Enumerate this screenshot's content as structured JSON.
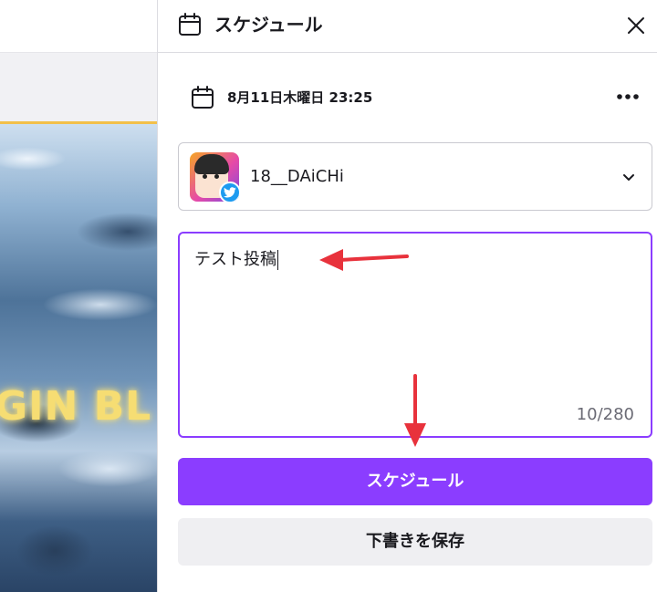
{
  "editor": {
    "canvas_text": "GIN BL"
  },
  "panel": {
    "title": "スケジュール",
    "header_icon": "calendar-icon",
    "close_icon": "close-icon",
    "date_icon": "calendar-icon",
    "date_text": "8月11日木曜日 23:25",
    "more_icon": "more-dots-icon"
  },
  "account": {
    "name": "18__DAiCHi",
    "platform_icon": "twitter-icon",
    "dropdown_icon": "chevron-down-icon"
  },
  "post": {
    "text": "テスト投稿",
    "char_count": "10/280"
  },
  "actions": {
    "schedule_label": "スケジュール",
    "save_draft_label": "下書きを保存"
  },
  "colors": {
    "accent": "#8b3dff",
    "annotation": "#e8323c",
    "twitter": "#1d9bf0"
  }
}
